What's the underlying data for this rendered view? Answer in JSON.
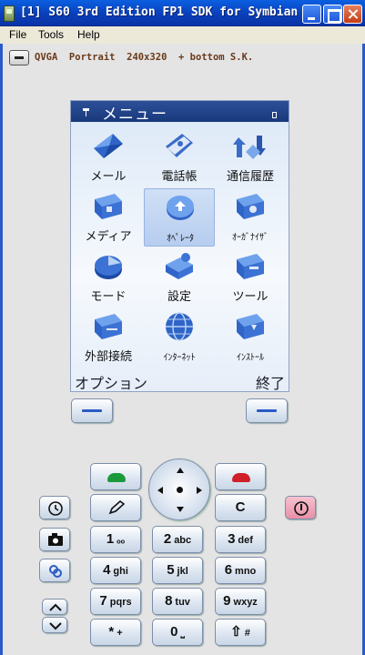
{
  "window": {
    "title": "[1] S60 3rd Edition FP1 SDK for Symbian O..."
  },
  "menubar": {
    "items": [
      "File",
      "Tools",
      "Help"
    ]
  },
  "emulator": {
    "layout_label": "QVGA  Portrait  240x320  + bottom S.K."
  },
  "screen": {
    "title": "メニュー",
    "items": [
      {
        "label": "メール",
        "icon": "mail-icon"
      },
      {
        "label": "電話帳",
        "icon": "contacts-icon"
      },
      {
        "label": "通信履歴",
        "icon": "call-log-icon"
      },
      {
        "label": "メディア",
        "icon": "media-folder-icon"
      },
      {
        "label": "ｵﾍﾟﾚｰﾀ",
        "icon": "operator-icon"
      },
      {
        "label": "ｵｰｶﾞﾅｲｻﾞ",
        "icon": "organizer-folder-icon"
      },
      {
        "label": "モード",
        "icon": "modes-icon"
      },
      {
        "label": "設定",
        "icon": "settings-icon"
      },
      {
        "label": "ツール",
        "icon": "tools-folder-icon"
      },
      {
        "label": "外部接続",
        "icon": "connectivity-folder-icon"
      },
      {
        "label": "ｲﾝﾀｰﾈｯﾄ",
        "icon": "internet-globe-icon"
      },
      {
        "label": "ｲﾝｽﾄｰﾙ",
        "icon": "install-folder-icon"
      }
    ],
    "selected_item": "ｵﾍﾟﾚｰﾀ",
    "softkey_left": "オプション",
    "softkey_right": "終了"
  },
  "keypad": {
    "clear_label": "C",
    "keys": [
      {
        "digit": "1",
        "letters": "ₒₒ"
      },
      {
        "digit": "2",
        "letters": "abc"
      },
      {
        "digit": "3",
        "letters": "def"
      },
      {
        "digit": "4",
        "letters": "ghi"
      },
      {
        "digit": "5",
        "letters": "jkl"
      },
      {
        "digit": "6",
        "letters": "mno"
      },
      {
        "digit": "7",
        "letters": "pqrs"
      },
      {
        "digit": "8",
        "letters": "tuv"
      },
      {
        "digit": "9",
        "letters": "wxyz"
      },
      {
        "digit": "*",
        "letters": "+"
      },
      {
        "digit": "0",
        "letters": "⎵"
      },
      {
        "digit": "⇧",
        "letters": "#"
      }
    ]
  },
  "colors": {
    "titlebar": "#0a3fbb",
    "screen_status_bar": "#19397c",
    "call_green": "#1a9a3a",
    "end_red": "#d0202a",
    "power_pink": "#e890a8"
  }
}
